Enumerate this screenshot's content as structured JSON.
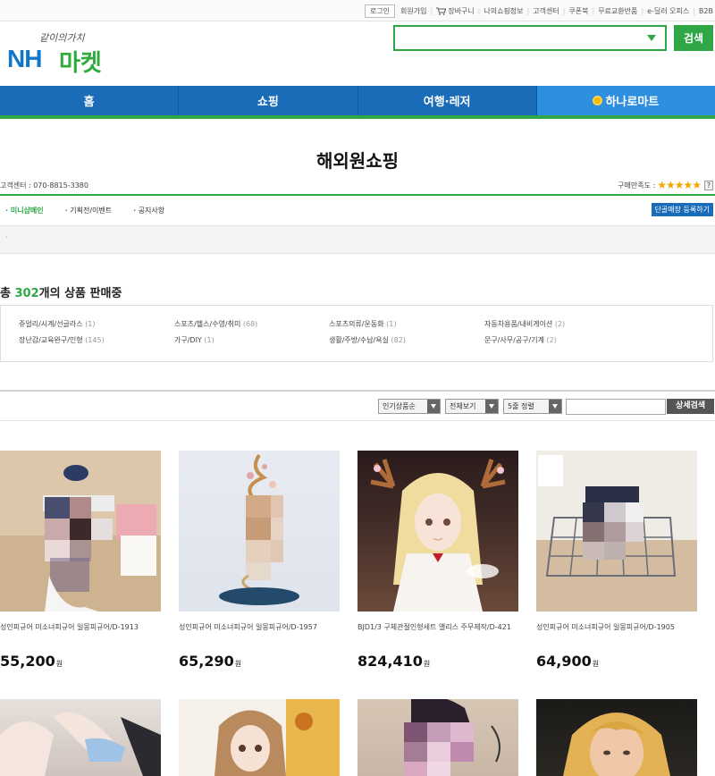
{
  "topnav": {
    "login": "로그인",
    "links": [
      "회원가입",
      "장바구니",
      "나의쇼핑정보",
      "고객센터",
      "쿠폰북",
      "무료교환반품",
      "e-딜러 오피스",
      "B2B"
    ]
  },
  "logo": {
    "tagline": "같이의가치",
    "nh": "NH",
    "market": "마켓"
  },
  "search": {
    "placeholder": "",
    "button": "검색"
  },
  "gnb": [
    {
      "label": "홈"
    },
    {
      "label": "쇼핑"
    },
    {
      "label": "여행·레저"
    },
    {
      "label": "하나로마트"
    }
  ],
  "shop": {
    "title": "해외원쇼핑",
    "customer_center": "고객센터 : 070-8815-3380",
    "rating_label": "구매만족도 :",
    "stars": "★★★★★",
    "help": "?"
  },
  "subnav": {
    "items": [
      "미니샵메인",
      "기획전/이벤트",
      "공지사항"
    ],
    "register_button": "단골매장 등록하기"
  },
  "notice": {
    "text": "·"
  },
  "summary": {
    "prefix": "총 ",
    "count": "302",
    "suffix": "개의 상품 판매중"
  },
  "categories": [
    {
      "name": "쥬얼리/시계/선글라스",
      "count": "(1)"
    },
    {
      "name": "스포츠/헬스/수영/취미",
      "count": "(68)"
    },
    {
      "name": "스포츠의류/운동화",
      "count": "(1)"
    },
    {
      "name": "자동차용품/내비게이션",
      "count": "(2)"
    },
    {
      "name": "장난감/교육완구/인형",
      "count": "(145)"
    },
    {
      "name": "가구/DIY",
      "count": "(1)"
    },
    {
      "name": "생활/주방/수납/욕실",
      "count": "(82)"
    },
    {
      "name": "문구/사무/공구/기계",
      "count": "(2)"
    }
  ],
  "filters": {
    "sort": "인기상품순",
    "view": "전체보기",
    "columns": "5줄 정렬",
    "search_button": "상세검색"
  },
  "products": [
    {
      "name": "성인피규어 미소녀피규어 일몽피규어/D-1913",
      "price": "55,200",
      "unit": "원"
    },
    {
      "name": "성인피규어 미소녀피규어 일몽피규어/D-1957",
      "price": "65,290",
      "unit": "원"
    },
    {
      "name": "BJD1/3 구체관절인형세트 앨리스 주무제작/D-421",
      "price": "824,410",
      "unit": "원"
    },
    {
      "name": "성인피규어 미소녀피규어 일몽피규어/D-1905",
      "price": "64,900",
      "unit": "원"
    }
  ]
}
